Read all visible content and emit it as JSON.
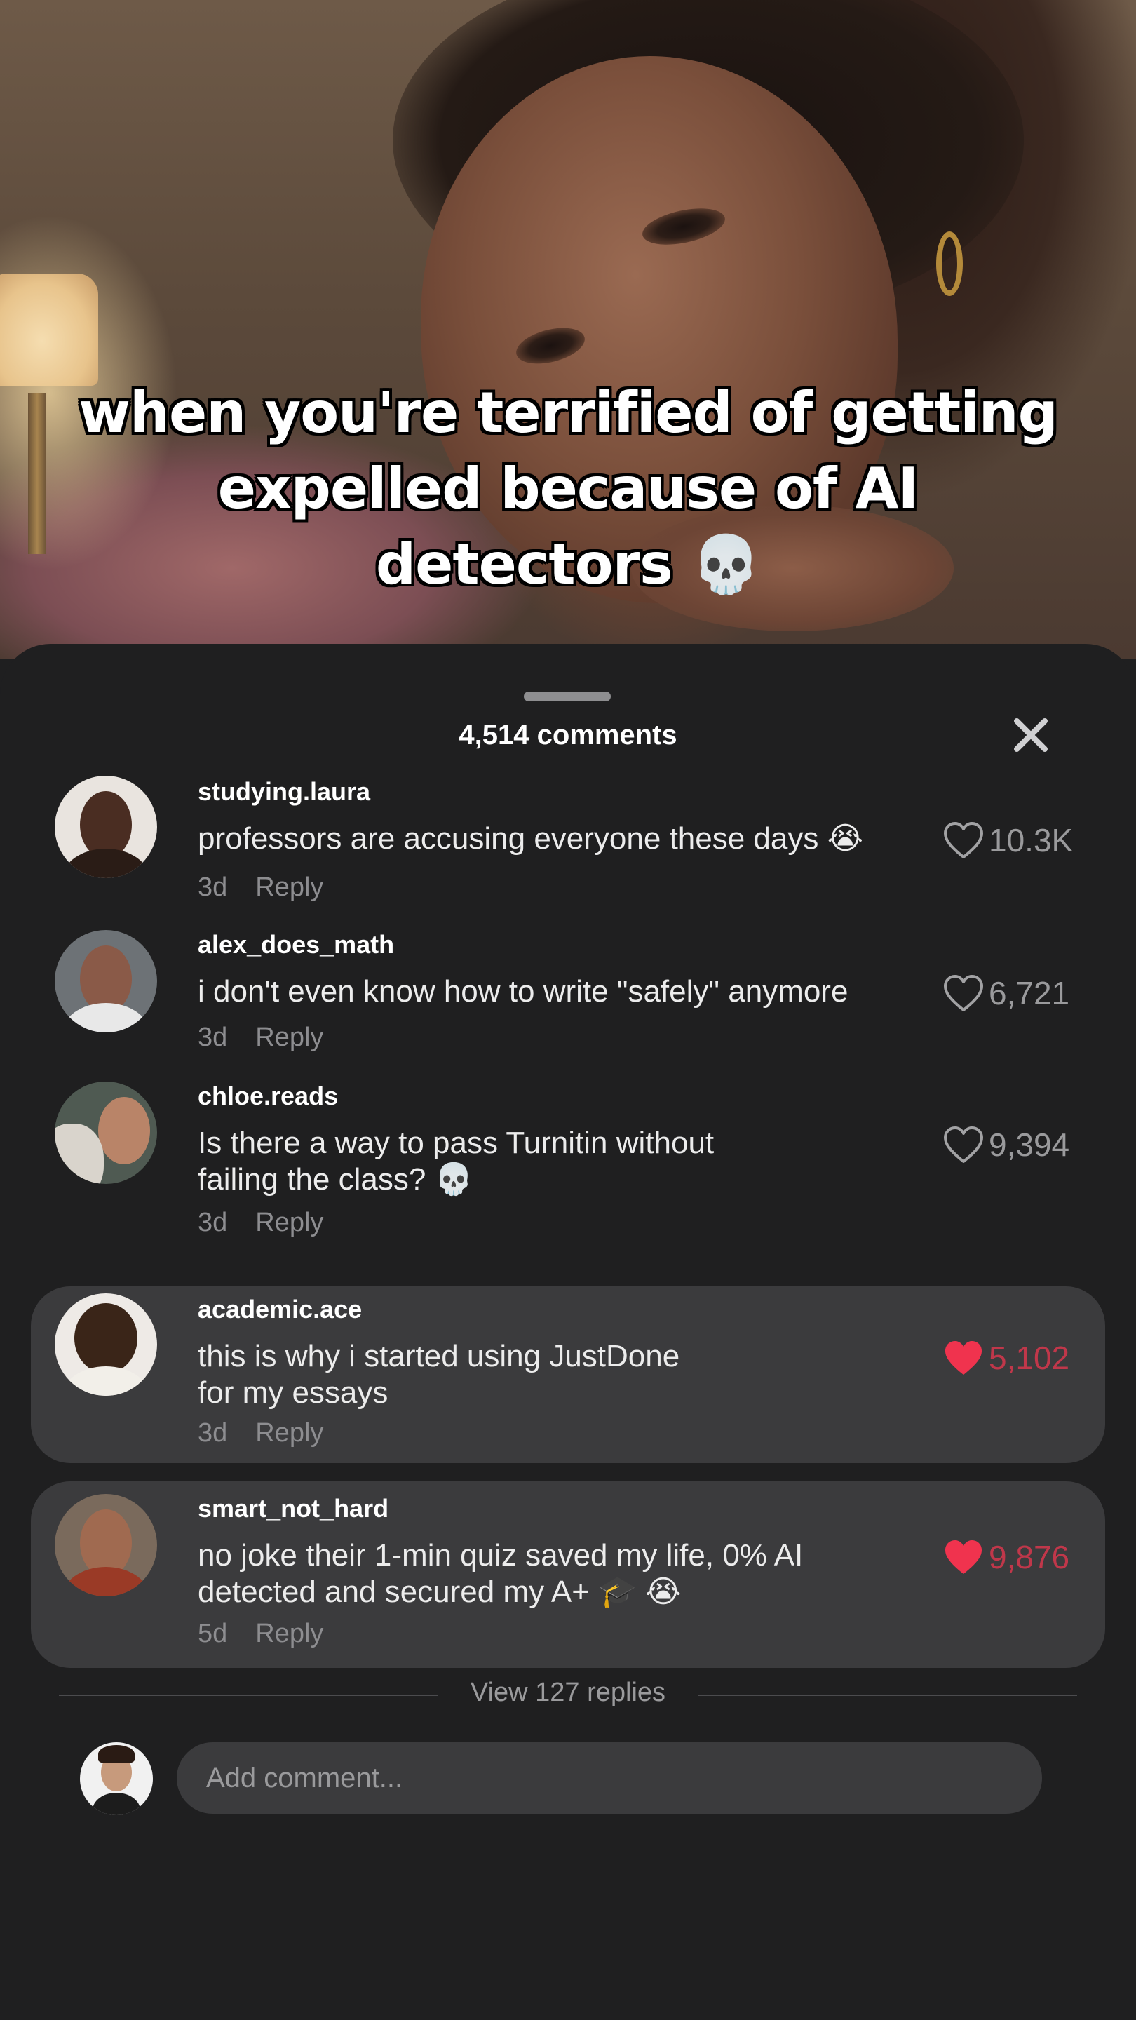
{
  "caption": {
    "line1": "when you're terrified of getting",
    "line2": "expelled because of AI",
    "line3": "detectors",
    "emoji": "💀"
  },
  "sheet": {
    "title": "4,514 comments",
    "close_icon": "close-icon"
  },
  "comments": [
    {
      "username": "studying.laura",
      "text": "professors are accusing everyone these days 😭",
      "time": "3d",
      "reply": "Reply",
      "likes": "10.3K",
      "liked": false
    },
    {
      "username": "alex_does_math",
      "text": "i don't even know how to write \"safely\" anymore",
      "time": "3d",
      "reply": "Reply",
      "likes": "6,721",
      "liked": false
    },
    {
      "username": "chloe.reads",
      "text_line1": "Is there a way to pass Turnitin without",
      "text_line2": "failing the class? 💀",
      "time": "3d",
      "reply": "Reply",
      "likes": "9,394",
      "liked": false
    },
    {
      "username": "academic.ace",
      "text_line1": "this is why i started using JustDone",
      "text_line2": "for my essays",
      "time": "3d",
      "reply": "Reply",
      "likes": "5,102",
      "liked": true
    },
    {
      "username": "smart_not_hard",
      "text_line1": "no joke their 1-min quiz saved my life, 0% AI",
      "text_line2": "detected and secured my A+ 🎓 😭",
      "time": "5d",
      "reply": "Reply",
      "likes": "9,876",
      "liked": true
    }
  ],
  "view_replies": "View 127 replies",
  "composer": {
    "placeholder": "Add comment..."
  },
  "colors": {
    "sheet_bg": "#1f1f20",
    "highlight_bg": "#3b3b3d",
    "liked_heart": "#f0334e",
    "liked_count": "#c0374a",
    "muted_text": "#8d8d90"
  }
}
